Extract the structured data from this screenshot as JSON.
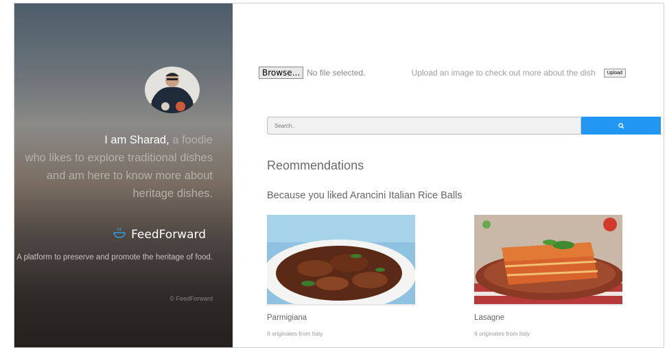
{
  "sidebar": {
    "name": "I am Sharad,",
    "bio_rest_1": " a foodie",
    "bio_line_2": "who likes to explore traditional dishes",
    "bio_line_3": "and am here to know more about",
    "bio_line_4": "heritage dishes.",
    "brand_name": "FeedForward",
    "tagline": "A platform to preserve and promote the heritage of food.",
    "copyright": "© FeedForward"
  },
  "upload": {
    "browse_label": "Browse...",
    "file_status": "No file selected.",
    "hint": "Upload an image to check out more about the dish",
    "button_label": "Upload"
  },
  "search": {
    "placeholder": "Search.."
  },
  "recommendations": {
    "title": "Reommendations",
    "because": "Because you liked Arancini Italian Rice Balls",
    "items": [
      {
        "name": "Parmigiana",
        "origin": "It originates from Italy"
      },
      {
        "name": "Lasagne",
        "origin": "It originates from Italy"
      }
    ]
  },
  "colors": {
    "accent": "#2196f3"
  }
}
